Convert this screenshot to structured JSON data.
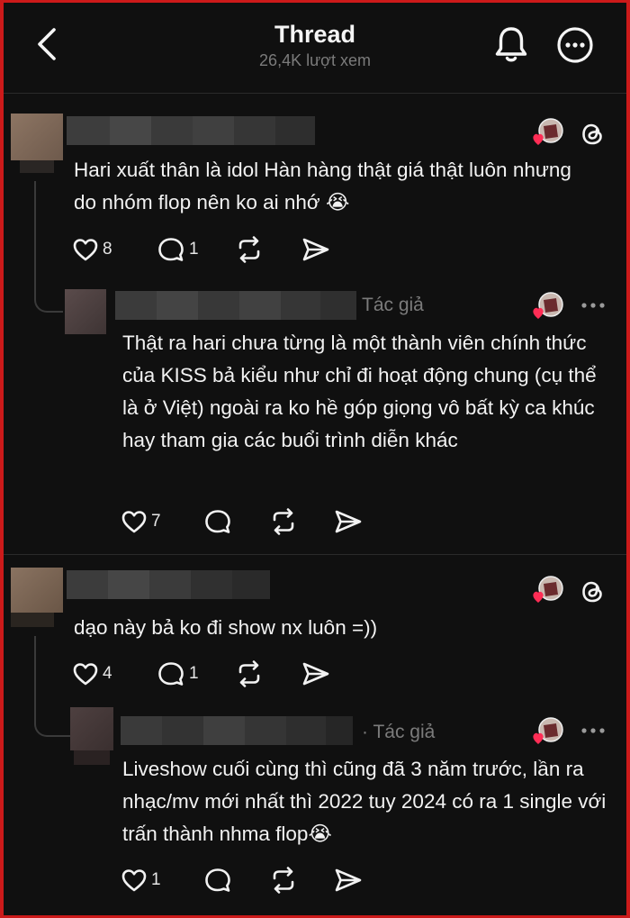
{
  "header": {
    "title": "Thread",
    "views": "26,4K lượt xem"
  },
  "comments": [
    {
      "text": "Hari xuất thân là idol Hàn hàng thật giá thật luôn nhưng do nhóm flop nên ko ai nhớ 😭",
      "likes": "8",
      "replies": "1",
      "reply": {
        "author_tag": "Tác giả",
        "text": "Thật ra hari chưa từng là một thành viên chính thức của KISS bả kiểu như chỉ đi hoạt động chung (cụ thể là ở Việt) ngoài ra ko hề góp giọng vô bất kỳ ca khúc hay tham gia các buổi trình diễn khác",
        "likes": "7"
      }
    },
    {
      "text": "dạo này bả ko đi show nx luôn =))",
      "likes": "4",
      "replies": "1",
      "reply": {
        "author_tag": "· Tác giả",
        "text": "Liveshow cuối cùng thì cũng đã 3 năm trước, lần ra nhạc/mv mới nhất thì 2022 tuy 2024 có ra 1 single với trấn thành nhma flop😭",
        "likes": "1"
      }
    }
  ],
  "icons": {
    "back": "chevron-left-icon",
    "bell": "bell-icon",
    "more": "more-circle-icon",
    "like": "heart-outline-icon",
    "reply": "comment-bubble-icon",
    "repost": "repost-icon",
    "share": "send-icon",
    "threads": "threads-logo-icon",
    "liked_by_author": "heart-avatar-icon"
  },
  "colors": {
    "background": "#101010",
    "border": "#cc1a1a",
    "text": "#f2f2f2",
    "muted": "#7b7b7b",
    "heart": "#ff2d55"
  }
}
